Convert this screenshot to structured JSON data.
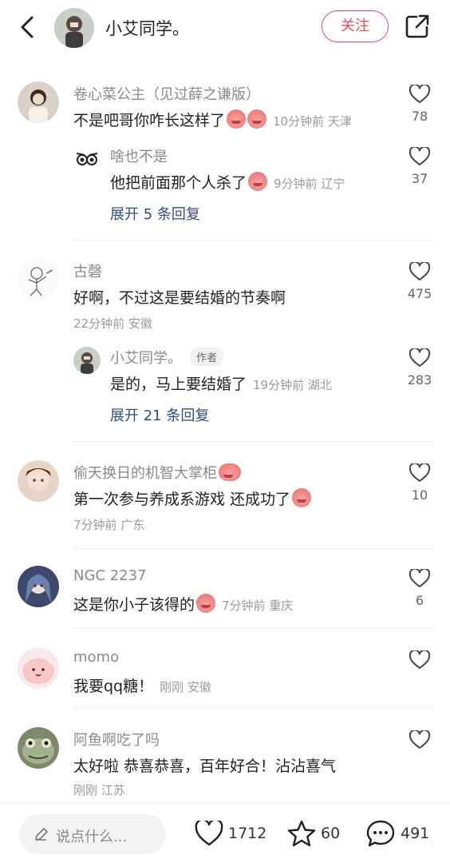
{
  "header": {
    "username": "小艾同学。",
    "follow_label": "关注"
  },
  "comments": [
    {
      "username": "卷心菜公主（见过薛之谦版）",
      "text": "不是吧哥你咋长这样了",
      "meta": "10分钟前 天津",
      "likes": "78",
      "replies": [
        {
          "username": "啥也不是",
          "text": "他把前面那个人杀了",
          "meta": "9分钟前 辽宁",
          "likes": "37"
        }
      ],
      "expand_label": "展开 5 条回复"
    },
    {
      "username": "古磬",
      "text": "好啊，不过这是要结婚的节奏啊",
      "meta": "22分钟前 安徽",
      "likes": "475",
      "replies": [
        {
          "username": "小艾同学。",
          "author_tag": "作者",
          "text": "是的，马上要结婚了",
          "meta": "19分钟前 湖北",
          "likes": "283"
        }
      ],
      "expand_label": "展开 21 条回复"
    },
    {
      "username": "偷天换日的机智大掌柜",
      "text": "第一次参与养成系游戏 还成功了",
      "meta": "7分钟前 广东",
      "likes": "10"
    },
    {
      "username": "NGC 2237",
      "text": "这是你小子该得的",
      "meta": "7分钟前 重庆",
      "likes": "6"
    },
    {
      "username": "momo",
      "text": "我要qq糖！",
      "meta": "刚刚 安徽",
      "likes": ""
    },
    {
      "username": "阿鱼啊吃了吗",
      "text": "太好啦 恭喜恭喜，百年好合！沾沾喜气",
      "meta": "刚刚 江苏",
      "likes": ""
    }
  ],
  "bottom": {
    "input_placeholder": "说点什么...",
    "likes": "1712",
    "stars": "60",
    "comments": "491"
  },
  "colors": {
    "accent": "#e8485b",
    "link": "#2f4f7f"
  }
}
